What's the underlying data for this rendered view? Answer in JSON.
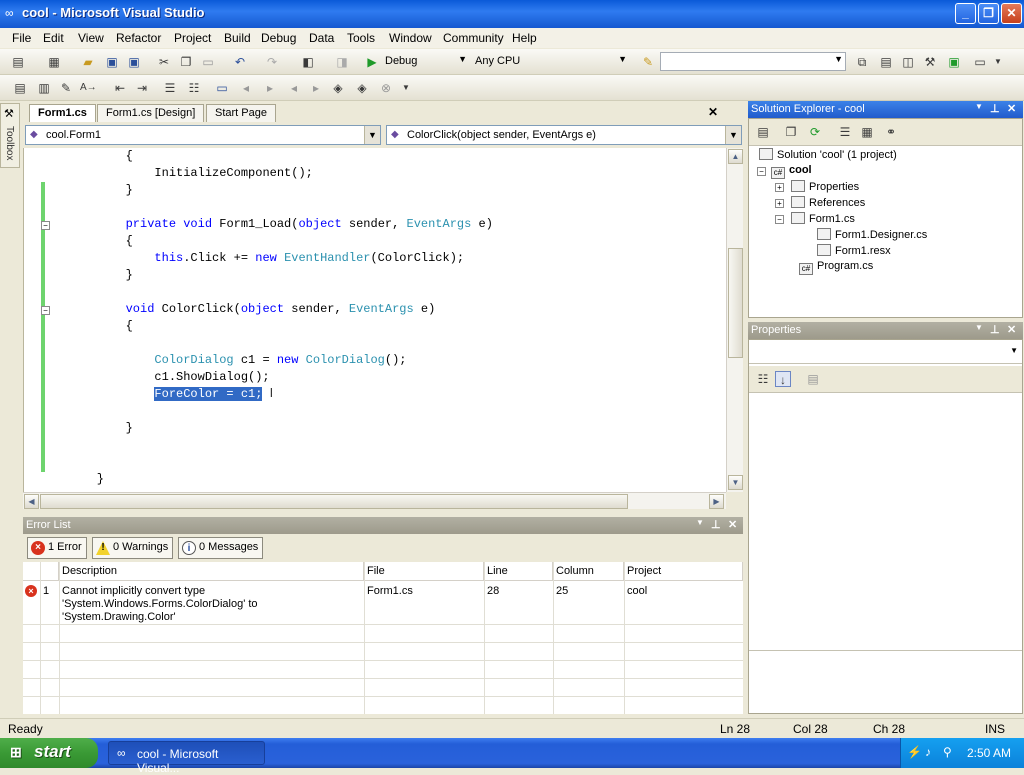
{
  "window": {
    "title": "cool - Microsoft Visual Studio"
  },
  "menu": [
    "File",
    "Edit",
    "View",
    "Refactor",
    "Project",
    "Build",
    "Debug",
    "Data",
    "Tools",
    "Window",
    "Community",
    "Help"
  ],
  "toolbar": {
    "config": "Debug",
    "platform": "Any CPU",
    "find_value": ""
  },
  "toolbox_label": "Toolbox",
  "editor": {
    "tabs": [
      "Form1.cs",
      "Form1.cs [Design]",
      "Start Page"
    ],
    "type_combo": "cool.Form1",
    "member_combo": "ColorClick(object sender, EventArgs e)"
  },
  "code": {
    "l1": "        {",
    "l2_ind": "            ",
    "l2": "InitializeComponent();",
    "l3": "        }",
    "l4_ind": "        ",
    "l4_kw1": "private",
    "l4_kw2": "void",
    "l4_name": " Form1_Load(",
    "l4_kw3": "object",
    "l4_mid": " sender, ",
    "l4_ty": "EventArgs",
    "l4_end": " e)",
    "l5": "        {",
    "l6_ind": "            ",
    "l6_kw1": "this",
    "l6_mid": ".Click += ",
    "l6_kw2": "new",
    "l6_ty": "EventHandler",
    "l6_end": "(ColorClick);",
    "l7": "        }",
    "l8_ind": "        ",
    "l8_kw1": "void",
    "l8_name": " ColorClick(",
    "l8_kw2": "object",
    "l8_mid": " sender, ",
    "l8_ty": "EventArgs",
    "l8_end": " e)",
    "l9": "        {",
    "l10_ind": "            ",
    "l10_ty1": "ColorDialog",
    "l10_mid": " c1 = ",
    "l10_kw": "new",
    "l10_ty2": "ColorDialog",
    "l10_end": "();",
    "l11": "            c1.ShowDialog();",
    "l12_ind": "            ",
    "l12_sel": "ForeColor = c1;",
    "l13": "        }",
    "l14": "    }"
  },
  "error_list": {
    "title": "Error List",
    "filters": {
      "errors": "1 Error",
      "warnings": "0 Warnings",
      "messages": "0 Messages"
    },
    "columns": [
      "Description",
      "File",
      "Line",
      "Column",
      "Project"
    ],
    "rows": [
      {
        "num": "1",
        "desc1": "Cannot implicitly convert type",
        "desc2": "'System.Windows.Forms.ColorDialog' to",
        "desc3": "'System.Drawing.Color'",
        "file": "Form1.cs",
        "line": "28",
        "column": "25",
        "project": "cool"
      }
    ]
  },
  "solution_explorer": {
    "title": "Solution Explorer - cool",
    "solution": "Solution 'cool' (1 project)",
    "project": "cool",
    "items": [
      "Properties",
      "References",
      "Form1.cs",
      "Form1.Designer.cs",
      "Form1.resx",
      "Program.cs"
    ]
  },
  "properties": {
    "title": "Properties",
    "object_value": ""
  },
  "status": {
    "left": "Ready",
    "ln": "Ln 28",
    "col": "Col 28",
    "ch": "Ch 28",
    "mode": "INS"
  },
  "taskbar": {
    "start": "start",
    "item": "cool - Microsoft Visual...",
    "clock": "2:50 AM"
  }
}
